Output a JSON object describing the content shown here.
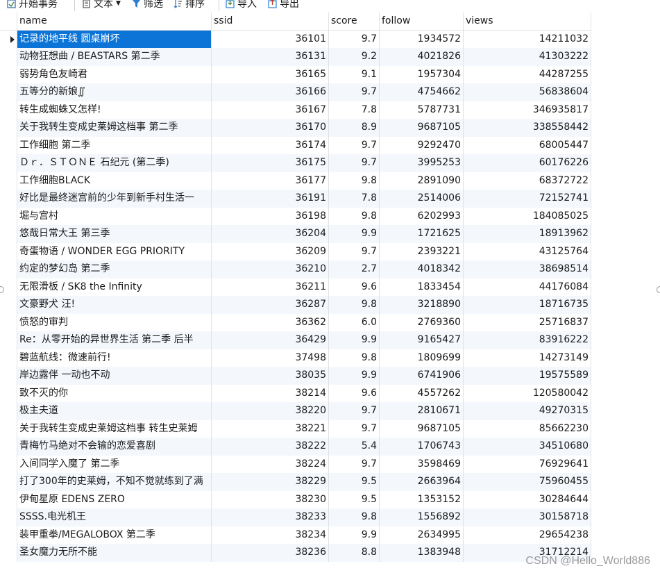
{
  "toolbar": {
    "begin_transaction": "开始事务",
    "text": "文本",
    "filter": "筛选",
    "sort": "排序",
    "import": "导入",
    "export": "导出"
  },
  "columns": [
    "name",
    "ssid",
    "score",
    "follow",
    "views"
  ],
  "rows": [
    [
      "记录的地平线 圆桌崩坏",
      "36101",
      "9.7",
      "1934572",
      "14211032"
    ],
    [
      "动物狂想曲 / BEASTARS 第二季",
      "36131",
      "9.2",
      "4021826",
      "41303222"
    ],
    [
      "弱势角色友崎君",
      "36165",
      "9.1",
      "1957304",
      "44287255"
    ],
    [
      "五等分的新娘∬",
      "36166",
      "9.7",
      "4754662",
      "56838604"
    ],
    [
      "转生成蜘蛛又怎样!",
      "36167",
      "7.8",
      "5787731",
      "346935817"
    ],
    [
      "关于我转生变成史莱姆这档事 第二季",
      "36170",
      "8.9",
      "9687105",
      "338558442"
    ],
    [
      "工作细胞 第二季",
      "36174",
      "9.7",
      "9292470",
      "68005447"
    ],
    [
      "Ｄｒ．ＳＴＯＮＥ 石纪元 (第二季)",
      "36175",
      "9.7",
      "3995253",
      "60176226"
    ],
    [
      "工作细胞BLACK",
      "36177",
      "9.8",
      "2891090",
      "68372722"
    ],
    [
      "好比是最终迷宫前的少年到新手村生活一",
      "36191",
      "7.8",
      "2514006",
      "72152741"
    ],
    [
      "堀与宫村",
      "36198",
      "9.8",
      "6202993",
      "184085025"
    ],
    [
      "悠哉日常大王 第三季",
      "36204",
      "9.9",
      "1721625",
      "18913962"
    ],
    [
      "奇蛋物语 / WONDER EGG PRIORITY",
      "36209",
      "9.7",
      "2393221",
      "43125764"
    ],
    [
      "约定的梦幻岛 第二季",
      "36210",
      "2.7",
      "4018342",
      "38698514"
    ],
    [
      "无限滑板 / SK8 the Infinity",
      "36211",
      "9.6",
      "1833454",
      "44176084"
    ],
    [
      "文豪野犬 汪!",
      "36287",
      "9.8",
      "3218890",
      "18716735"
    ],
    [
      "愤怒的审判",
      "36362",
      "6.0",
      "2769360",
      "25716837"
    ],
    [
      "Re：从零开始的异世界生活 第二季 后半",
      "36429",
      "9.9",
      "9165427",
      "83916222"
    ],
    [
      "碧蓝航线：微速前行!",
      "37498",
      "9.8",
      "1809699",
      "14273149"
    ],
    [
      "岸边露伴 一动也不动",
      "38035",
      "9.9",
      "6741906",
      "19575589"
    ],
    [
      "致不灭的你",
      "38214",
      "9.6",
      "4557262",
      "120580042"
    ],
    [
      "极主夫道",
      "38220",
      "9.7",
      "2810671",
      "49270315"
    ],
    [
      "关于我转生变成史莱姆这档事 转生史莱姆",
      "38221",
      "9.7",
      "9687105",
      "85662230"
    ],
    [
      "青梅竹马绝对不会输的恋爱喜剧",
      "38222",
      "5.4",
      "1706743",
      "34510680"
    ],
    [
      "入间同学入魔了 第二季",
      "38224",
      "9.7",
      "3598469",
      "76929641"
    ],
    [
      "打了300年的史莱姆，不知不觉就练到了满",
      "38229",
      "9.5",
      "2663964",
      "75960455"
    ],
    [
      "伊甸星原 EDENS ZERO",
      "38230",
      "9.5",
      "1353152",
      "30284644"
    ],
    [
      "SSSS.电光机王",
      "38233",
      "9.8",
      "1556892",
      "30158718"
    ],
    [
      "装甲重拳/MEGALOBOX 第二季",
      "38234",
      "9.9",
      "2634995",
      "29654238"
    ],
    [
      "圣女魔力无所不能",
      "38236",
      "8.8",
      "1383948",
      "31712214"
    ]
  ],
  "selected_row": 0,
  "watermark": "CSDN @Hello_World886",
  "colors": {
    "selection": "#0b74d6",
    "alt_row": "#f4f7fc",
    "grid_line": "#e2e2e2"
  }
}
